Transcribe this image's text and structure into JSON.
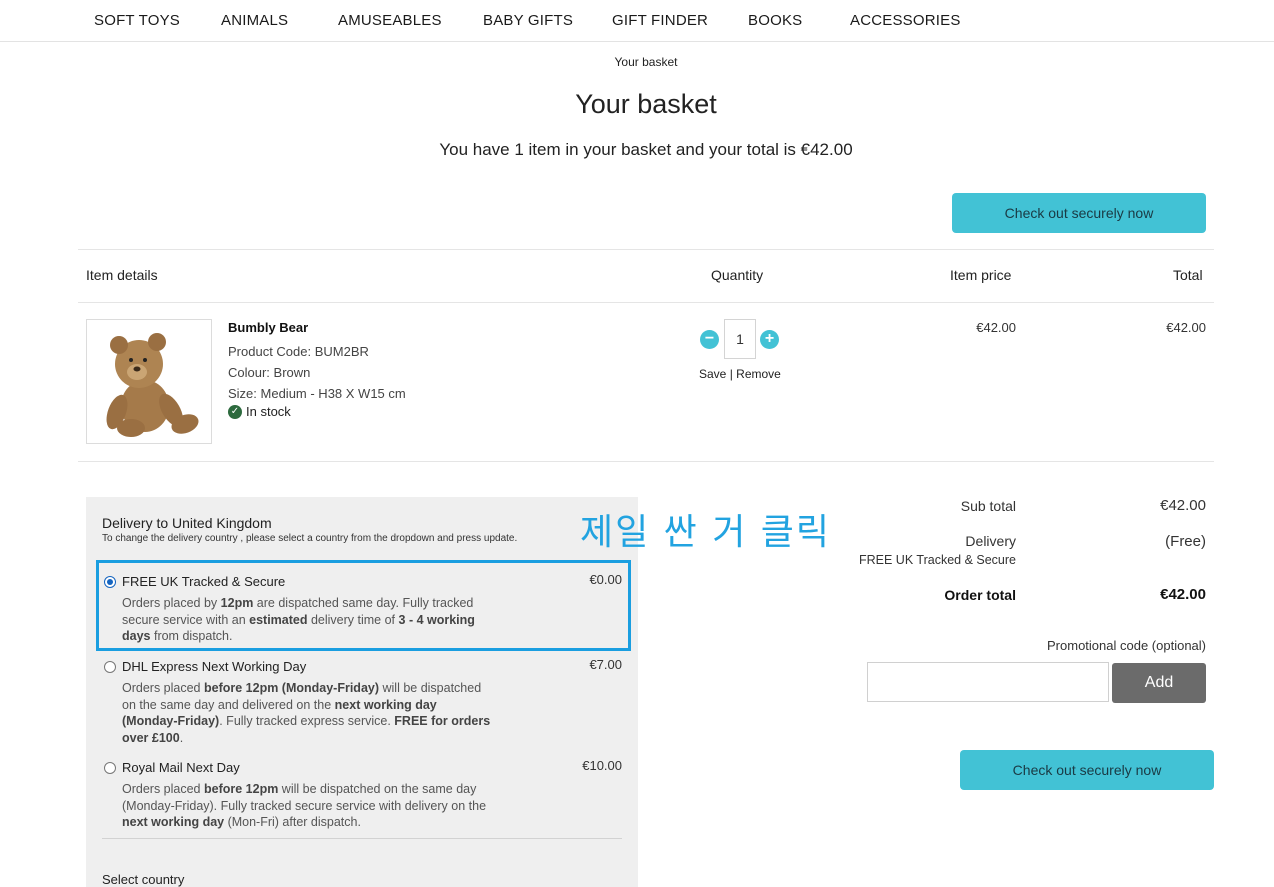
{
  "nav": [
    "SOFT TOYS",
    "ANIMALS",
    "AMUSEABLES",
    "BABY GIFTS",
    "GIFT FINDER",
    "BOOKS",
    "ACCESSORIES"
  ],
  "breadcrumb": "Your basket",
  "title": "Your basket",
  "summary": "You have 1 item in your basket and your total is €42.00",
  "checkout_label": "Check out securely now",
  "columns": {
    "item": "Item details",
    "quantity": "Quantity",
    "price": "Item price",
    "total": "Total"
  },
  "item": {
    "name": "Bumbly Bear",
    "code": "Product Code: BUM2BR",
    "colour": "Colour: Brown",
    "size": "Size: Medium - H38 X W15 cm",
    "stock": "In stock",
    "quantity": "1",
    "save": "Save",
    "separator": "|",
    "remove": "Remove",
    "price": "€42.00",
    "total": "€42.00"
  },
  "delivery": {
    "title": "Delivery to United Kingdom",
    "subtitle": "To change the delivery country , please select a country from the dropdown and press update.",
    "select_country": "Select country",
    "options": [
      {
        "name": "FREE UK Tracked & Secure",
        "cost": "€0.00",
        "selected": true
      },
      {
        "name": "DHL Express Next Working Day",
        "cost": "€7.00",
        "selected": false
      },
      {
        "name": "Royal Mail Next Day",
        "cost": "€10.00",
        "selected": false
      }
    ],
    "desc0": [
      "Orders placed by ",
      "12pm",
      " are dispatched same day. Fully tracked secure service with an ",
      "estimated",
      " delivery time of ",
      "3 - 4 working days",
      " from dispatch."
    ],
    "desc1": [
      "Orders placed ",
      "before 12pm (Monday-Friday)",
      " will be dispatched on the same day and delivered on the ",
      "next working day (Monday-Friday)",
      ". Fully tracked express service. ",
      "FREE for orders over £100",
      "."
    ],
    "desc2": [
      "Orders placed ",
      "before 12pm",
      " will be dispatched on the same day (Monday-Friday). Fully tracked secure service with delivery on the ",
      "next working day",
      " (Mon-Fri) after dispatch."
    ]
  },
  "annotation": "제일 싼 거 클릭",
  "totals": {
    "subtotal_label": "Sub total",
    "subtotal": "€42.00",
    "delivery_label": "Delivery",
    "delivery_method": "FREE UK Tracked & Secure",
    "delivery_value": "(Free)",
    "order_total_label": "Order total",
    "order_total": "€42.00"
  },
  "promo": {
    "label": "Promotional code (optional)",
    "placeholder": "",
    "button": "Add"
  }
}
